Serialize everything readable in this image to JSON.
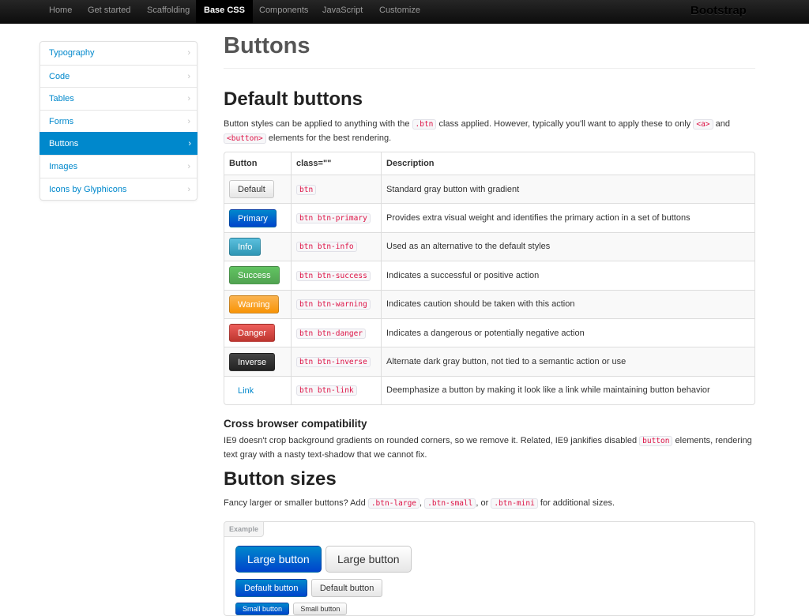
{
  "navbar": {
    "items": [
      "Home",
      "Get started",
      "Scaffolding",
      "Base CSS",
      "Components",
      "JavaScript",
      "Customize"
    ],
    "active": "Base CSS",
    "brand": "Bootstrap"
  },
  "sidebar": {
    "items": [
      {
        "label": "Typography"
      },
      {
        "label": "Code"
      },
      {
        "label": "Tables"
      },
      {
        "label": "Forms"
      },
      {
        "label": "Buttons"
      },
      {
        "label": "Images"
      },
      {
        "label": "Icons by Glyphicons"
      }
    ],
    "active": "Buttons",
    "chevron": "›"
  },
  "page": {
    "title": "Buttons",
    "default_heading": "Default buttons",
    "intro": {
      "t1": "Button styles can be applied to anything with the",
      "c1": ".btn",
      "t2": "class applied. However, typically you'll want to apply these to only",
      "c2": "<a>",
      "t3": "and",
      "c3": "<button>",
      "t4": "elements for the best rendering."
    },
    "table": {
      "headers": [
        "Button",
        "class=\"\"",
        "Description"
      ],
      "rows": [
        {
          "button": "Default",
          "class": "btn",
          "desc": "Standard gray button with gradient"
        },
        {
          "button": "Primary",
          "class": "btn btn-primary",
          "desc": "Provides extra visual weight and identifies the primary action in a set of buttons"
        },
        {
          "button": "Info",
          "class": "btn btn-info",
          "desc": "Used as an alternative to the default styles"
        },
        {
          "button": "Success",
          "class": "btn btn-success",
          "desc": "Indicates a successful or positive action"
        },
        {
          "button": "Warning",
          "class": "btn btn-warning",
          "desc": "Indicates caution should be taken with this action"
        },
        {
          "button": "Danger",
          "class": "btn btn-danger",
          "desc": "Indicates a dangerous or potentially negative action"
        },
        {
          "button": "Inverse",
          "class": "btn btn-inverse",
          "desc": "Alternate dark gray button, not tied to a semantic action or use"
        },
        {
          "button": "Link",
          "class": "btn btn-link",
          "desc": "Deemphasize a button by making it look like a link while maintaining button behavior"
        }
      ]
    },
    "compat": {
      "heading": "Cross browser compatibility",
      "t1": "IE9 doesn't crop background gradients on rounded corners, so we remove it. Related, IE9 jankifies disabled",
      "c1": "button",
      "t2": "elements, rendering text gray with a nasty text-shadow that we cannot fix."
    },
    "sizes": {
      "heading": "Button sizes",
      "t1": "Fancy larger or smaller buttons? Add",
      "c1": ".btn-large",
      "sep1": ",",
      "c2": ".btn-small",
      "sep2": ", or",
      "c3": ".btn-mini",
      "t2": "for additional sizes."
    },
    "example": {
      "label": "Example",
      "large_primary": "Large button",
      "large_default": "Large button",
      "default_primary": "Default button",
      "default_default": "Default button",
      "small_primary": "Small button",
      "small_default": "Small button"
    }
  },
  "colors": {
    "link": "#0088cc",
    "code": "#d14",
    "navbar": "#1b1b1b"
  }
}
